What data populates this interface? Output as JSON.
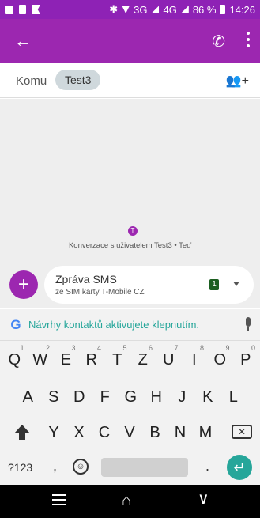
{
  "status_bar": {
    "network": "3G",
    "network2": "4G",
    "battery": "86 %",
    "time": "14:26"
  },
  "appbar": {
    "back_icon": "arrow-left-icon",
    "call_icon": "phone-icon",
    "more_icon": "more-vert-icon"
  },
  "recipients": {
    "label": "Komu",
    "chip": "Test3",
    "add_icon": "add-person-icon"
  },
  "conversation": {
    "avatar_letter": "T",
    "info": "Konverzace s uživatelem Test3 • Teď"
  },
  "compose": {
    "title": "Zpráva SMS",
    "subtitle": "ze SIM karty T-Mobile CZ",
    "sim_number": "1"
  },
  "keyboard": {
    "suggestion": "Návrhy kontaktů aktivujete klepnutím.",
    "row1": [
      {
        "k": "Q",
        "n": "1"
      },
      {
        "k": "W",
        "n": "2"
      },
      {
        "k": "E",
        "n": "3"
      },
      {
        "k": "R",
        "n": "4"
      },
      {
        "k": "T",
        "n": "5"
      },
      {
        "k": "Z",
        "n": "6"
      },
      {
        "k": "U",
        "n": "7"
      },
      {
        "k": "I",
        "n": "8"
      },
      {
        "k": "O",
        "n": "9"
      },
      {
        "k": "P",
        "n": "0"
      }
    ],
    "row2": [
      "A",
      "S",
      "D",
      "F",
      "G",
      "H",
      "J",
      "K",
      "L"
    ],
    "row3": [
      "Y",
      "X",
      "C",
      "V",
      "B",
      "N",
      "M"
    ],
    "sym_key": "?123",
    "comma": ",",
    "period": "."
  },
  "navbar": {
    "menu_icon": "menu-icon",
    "home_icon": "home-icon",
    "back_icon": "back-triangle-icon"
  }
}
